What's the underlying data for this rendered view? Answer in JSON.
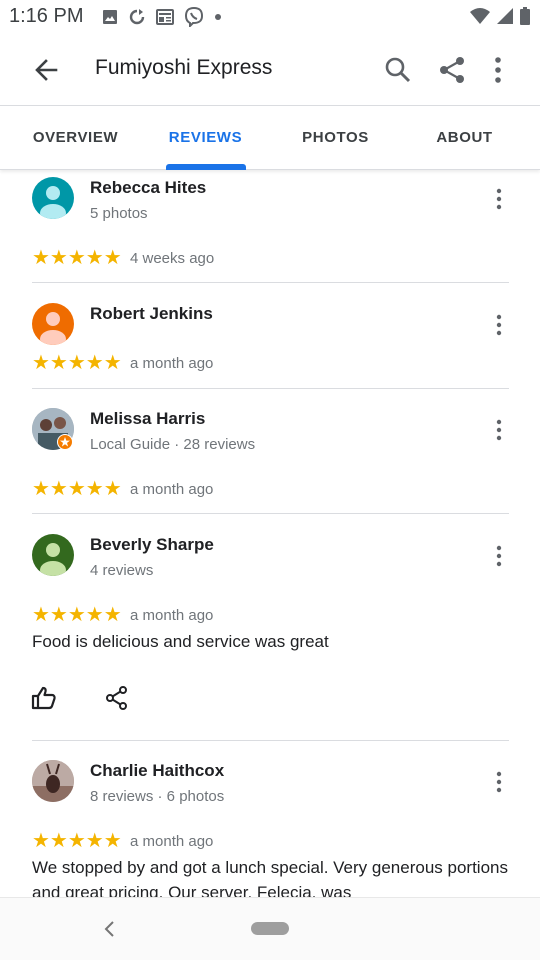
{
  "status_bar": {
    "time": "1:16 PM",
    "icons": [
      "image-icon",
      "sync-icon",
      "news-icon",
      "viber-icon",
      "dot-icon",
      "wifi-icon",
      "signal-icon",
      "battery-icon"
    ]
  },
  "app_bar": {
    "title": "Fumiyoshi Express",
    "icons": [
      "back-arrow-icon",
      "search-icon",
      "share-icon",
      "more-vert-icon"
    ]
  },
  "tabs": [
    {
      "label": "OVERVIEW",
      "active": false
    },
    {
      "label": "REVIEWS",
      "active": true
    },
    {
      "label": "PHOTOS",
      "active": false
    },
    {
      "label": "ABOUT",
      "active": false
    }
  ],
  "colors": {
    "accent": "#1a73e8",
    "star": "#f4b400",
    "avatar_teal": "#0097a7",
    "avatar_orange": "#ef6c00",
    "avatar_green": "#33691e",
    "local_guide_badge": "#f57c00"
  },
  "reviews": [
    {
      "name": "Rebecca Hites",
      "meta": "5 photos",
      "rating": 5,
      "stars": "★★★★★",
      "date": "4 weeks ago",
      "text": ""
    },
    {
      "name": "Robert Jenkins",
      "meta": "",
      "rating": 5,
      "stars": "★★★★★",
      "date": "a month ago",
      "text": ""
    },
    {
      "name": "Melissa Harris",
      "meta": "Local Guide · 28 reviews",
      "rating": 5,
      "stars": "★★★★★",
      "date": "a month ago",
      "text": ""
    },
    {
      "name": "Beverly Sharpe",
      "meta": "4 reviews",
      "rating": 5,
      "stars": "★★★★★",
      "date": "a month ago",
      "text": "Food is delicious and service was great",
      "actions": [
        "thumb-up-icon",
        "share-icon"
      ]
    },
    {
      "name": "Charlie Haithcox",
      "meta": "8 reviews · 6 photos",
      "rating": 5,
      "stars": "★★★★★",
      "date": "a month ago",
      "text": "We stopped by and got a lunch special.  Very generous portions and great pricing.  Our server, Felecia, was"
    }
  ],
  "nav_bar": {
    "icons": [
      "nav-back-icon",
      "nav-home-pill"
    ]
  }
}
